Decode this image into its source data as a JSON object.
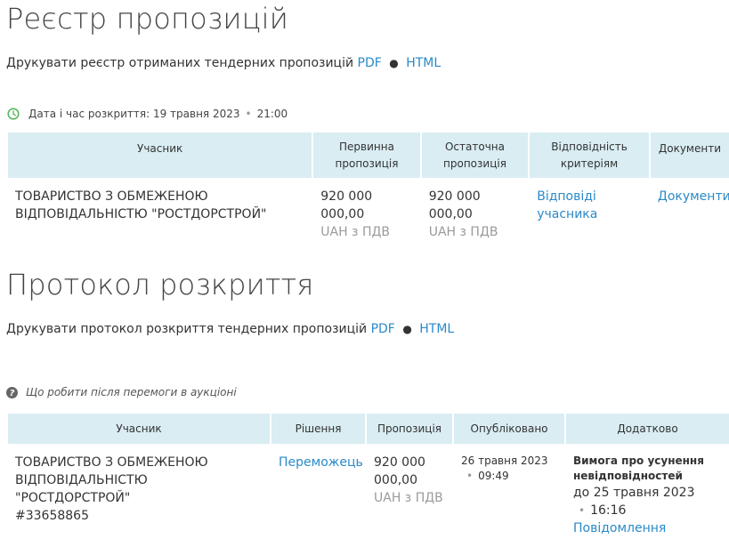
{
  "registry": {
    "title": "Реєстр пропозицій",
    "print_text": "Друкувати реєстр отриманих тендерних пропозицій",
    "pdf_label": "PDF",
    "separator": "●",
    "html_label": "HTML",
    "opening_label": "Дата і час розкриття: 19 травня 2023",
    "opening_time": "21:00",
    "headers": [
      "Учасник",
      "Первинна пропозиція",
      "Остаточна пропозиція",
      "Відповідність критеріям",
      "Документи"
    ],
    "row": {
      "participant": "ТОВАРИСТВО З ОБМЕЖЕНОЮ ВІДПОВІДАЛЬНІСТЮ \"РОСТДОРСТРОЙ\"",
      "initial_amount": "920 000 000,00",
      "initial_currency": "UAH з ПДВ",
      "final_amount": "920 000 000,00",
      "final_currency": "UAH з ПДВ",
      "criteria_link": "Відповіді учасника",
      "documents_link": "Документи"
    }
  },
  "protocol": {
    "title": "Протокол розкриття",
    "print_text": "Друкувати протокол розкриття тендерних пропозицій",
    "pdf_label": "PDF",
    "separator": "●",
    "html_label": "HTML",
    "help_text": "Що робити після перемоги в аукціоні",
    "headers": [
      "Учасник",
      "Рішення",
      "Пропозиція",
      "Опубліковано",
      "Додатково"
    ],
    "row": {
      "participant": "ТОВАРИСТВО З ОБМЕЖЕНОЮ ВІДПОВІДАЛЬНІСТЮ \"РОСТДОРСТРОЙ\"",
      "participant_code": "#33658865",
      "decision_link": "Переможець",
      "amount": "920 000 000,00",
      "currency": "UAH з ПДВ",
      "published_date": "26 травня 2023",
      "published_time": "09:49",
      "extra_title": "Вимога про усунення невідповідностей",
      "extra_due": "до 25 травня 2023",
      "extra_time": "16:16",
      "extra_link": "Повідомлення"
    }
  },
  "colors": {
    "accent": "#2a8ac8",
    "header_bg": "#d9edf3",
    "clock_green": "#5cb85c"
  }
}
